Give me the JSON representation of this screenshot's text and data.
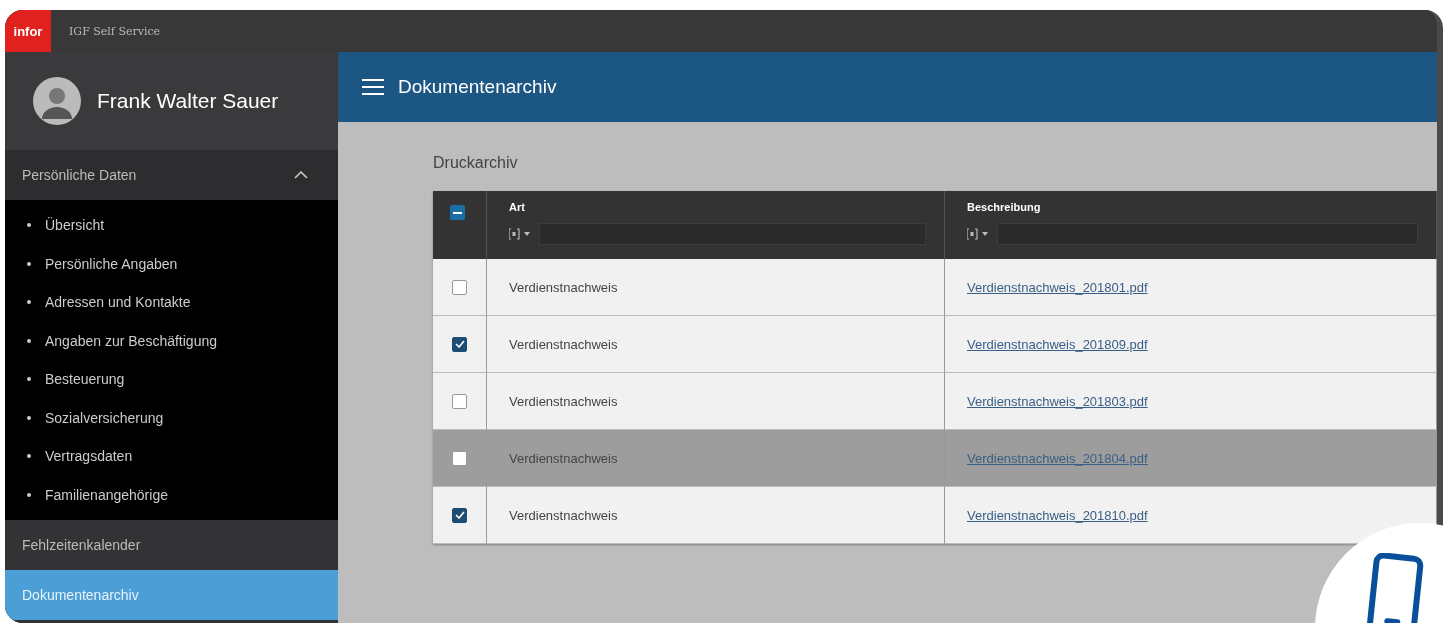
{
  "app": {
    "logo": "infor",
    "title": "IGF Self Service"
  },
  "user": {
    "name": "Frank Walter Sauer"
  },
  "sidebar": {
    "groups": [
      {
        "label": "Persönliche Daten",
        "expanded": true,
        "selected": false,
        "items": [
          "Übersicht",
          "Persönliche Angaben",
          "Adressen und Kontakte",
          "Angaben zur Beschäftigung",
          "Besteuerung",
          "Sozialversicherung",
          "Vertragsdaten",
          "Familienangehörige"
        ]
      },
      {
        "label": "Fehlzeitenkalender",
        "expanded": false,
        "selected": false
      },
      {
        "label": "Dokumentenarchiv",
        "expanded": false,
        "selected": true
      }
    ]
  },
  "header": {
    "title": "Dokumentenarchiv"
  },
  "section": {
    "title": "Druckarchiv"
  },
  "table": {
    "select_all": {
      "indeterminate": true
    },
    "columns": [
      {
        "label": "Art"
      },
      {
        "label": "Beschreibung"
      }
    ],
    "rows": [
      {
        "checked": false,
        "highlighted": false,
        "art": "Verdienstnachweis",
        "file": "Verdienstnachweis_201801.pdf"
      },
      {
        "checked": true,
        "highlighted": false,
        "art": "Verdienstnachweis",
        "file": "Verdienstnachweis_201809.pdf"
      },
      {
        "checked": false,
        "highlighted": false,
        "art": "Verdienstnachweis",
        "file": "Verdienstnachweis_201803.pdf"
      },
      {
        "checked": false,
        "highlighted": true,
        "art": "Verdienstnachweis",
        "file": "Verdienstnachweis_201804.pdf"
      },
      {
        "checked": true,
        "highlighted": false,
        "art": "Verdienstnachweis",
        "file": "Verdienstnachweis_201810.pdf"
      }
    ]
  }
}
